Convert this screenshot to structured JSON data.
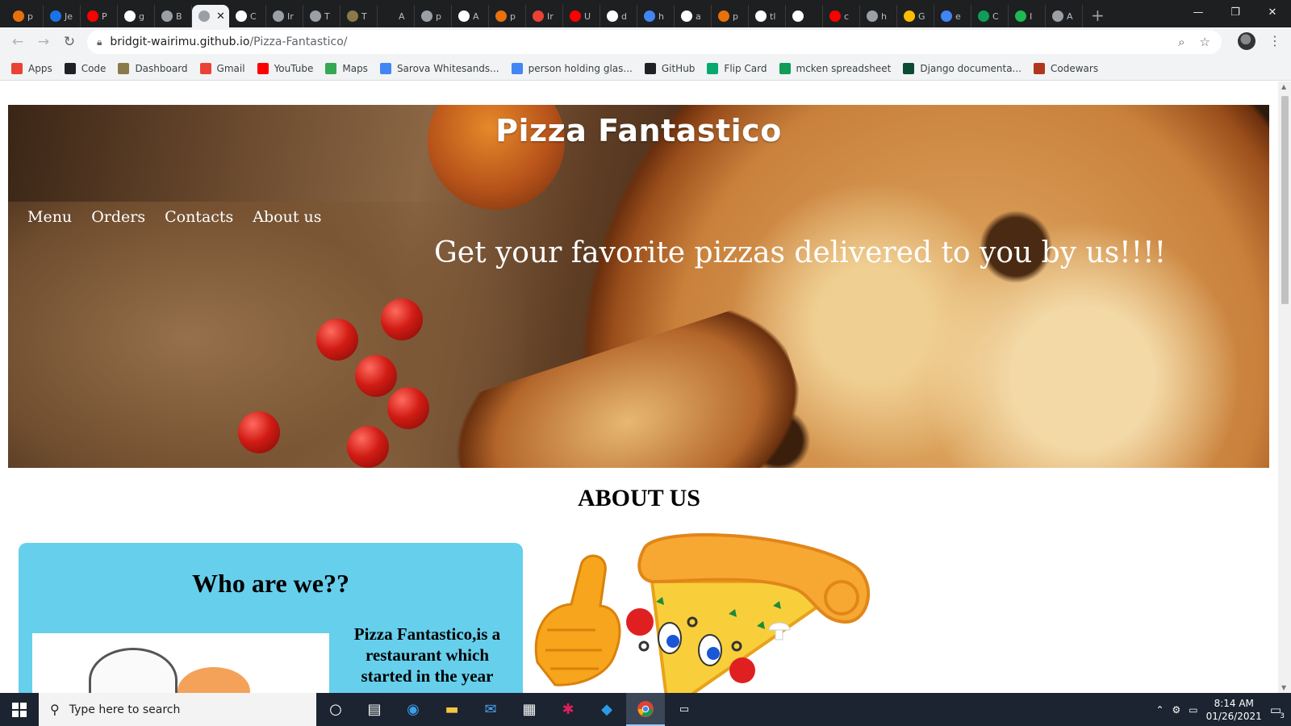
{
  "browser": {
    "tabs": [
      {
        "label": "p",
        "color": "#e8710a"
      },
      {
        "label": "Je",
        "color": "#1a73e8"
      },
      {
        "label": "P",
        "color": "#ff0000"
      },
      {
        "label": "g",
        "color": "#ffffff"
      },
      {
        "label": "B",
        "color": "#9aa0a6"
      },
      {
        "label": "",
        "color": "#9aa0a6",
        "active": true
      },
      {
        "label": "C",
        "color": "#ffffff"
      },
      {
        "label": "Ir",
        "color": "#9aa0a6"
      },
      {
        "label": "T",
        "color": "#9aa0a6"
      },
      {
        "label": "T",
        "color": "#8a7a4a"
      },
      {
        "label": "A",
        "color": "#1e1f21"
      },
      {
        "label": "p",
        "color": "#9aa0a6"
      },
      {
        "label": "A",
        "color": "#ffffff"
      },
      {
        "label": "p",
        "color": "#e8710a"
      },
      {
        "label": "Ir",
        "color": "#ea4335"
      },
      {
        "label": "U",
        "color": "#ff0000"
      },
      {
        "label": "d",
        "color": "#ffffff"
      },
      {
        "label": "h",
        "color": "#4285f4"
      },
      {
        "label": "a",
        "color": "#ffffff"
      },
      {
        "label": "p",
        "color": "#e8710a"
      },
      {
        "label": "tl",
        "color": "#ffffff"
      },
      {
        "label": "",
        "color": "#ffffff"
      },
      {
        "label": "c",
        "color": "#ff0000"
      },
      {
        "label": "h",
        "color": "#9aa0a6"
      },
      {
        "label": "G",
        "color": "#fbbc04"
      },
      {
        "label": "e",
        "color": "#4285f4"
      },
      {
        "label": "C",
        "color": "#0f9d58"
      },
      {
        "label": "I",
        "color": "#1db954"
      },
      {
        "label": "A",
        "color": "#9aa0a6"
      }
    ],
    "active_tab_close": "✕",
    "new_tab": "+",
    "url_host": "bridgit-wairimu.github.io",
    "url_path": "/Pizza-Fantastico/",
    "bookmarks": [
      {
        "label": "Apps",
        "icon": "apps-grid-icon",
        "color": "#ea4335"
      },
      {
        "label": "Code",
        "icon": "github-icon",
        "color": "#202124"
      },
      {
        "label": "Dashboard",
        "icon": "palm-icon",
        "color": "#8a7a4a"
      },
      {
        "label": "Gmail",
        "icon": "gmail-icon",
        "color": "#ea4335"
      },
      {
        "label": "YouTube",
        "icon": "youtube-icon",
        "color": "#ff0000"
      },
      {
        "label": "Maps",
        "icon": "maps-icon",
        "color": "#34a853"
      },
      {
        "label": "Sarova Whitesands...",
        "icon": "google-icon",
        "color": "#4285f4"
      },
      {
        "label": "person holding glas...",
        "icon": "google-icon",
        "color": "#4285f4"
      },
      {
        "label": "GitHub",
        "icon": "github-icon",
        "color": "#202124"
      },
      {
        "label": "Flip Card",
        "icon": "w3schools-icon",
        "color": "#04aa6d"
      },
      {
        "label": "mcken spreadsheet",
        "icon": "sheets-icon",
        "color": "#0f9d58"
      },
      {
        "label": "Django documenta...",
        "icon": "django-icon",
        "color": "#0c4b33"
      },
      {
        "label": "Codewars",
        "icon": "codewars-icon",
        "color": "#b1361e"
      }
    ]
  },
  "site": {
    "title": "Pizza Fantastico",
    "nav": [
      "Menu",
      "Orders",
      "Contacts",
      "About us"
    ],
    "tagline": "Get your favorite pizzas delivered to you by us!!!!",
    "about_heading": "ABOUT US",
    "who_title": "Who are we??",
    "who_text": "Pizza Fantastico,is a restaurant which started in the year",
    "card_color": "#66cfec"
  },
  "taskbar": {
    "search_placeholder": "Type here to search",
    "time": "8:14 AM",
    "date": "01/26/2021",
    "notification_count": "3",
    "apps": [
      "cortana-icon",
      "task-view-icon",
      "edge-icon",
      "file-explorer-icon",
      "mail-icon",
      "store-icon",
      "slack-icon",
      "vscode-icon",
      "chrome-icon",
      "terminal-icon"
    ]
  }
}
